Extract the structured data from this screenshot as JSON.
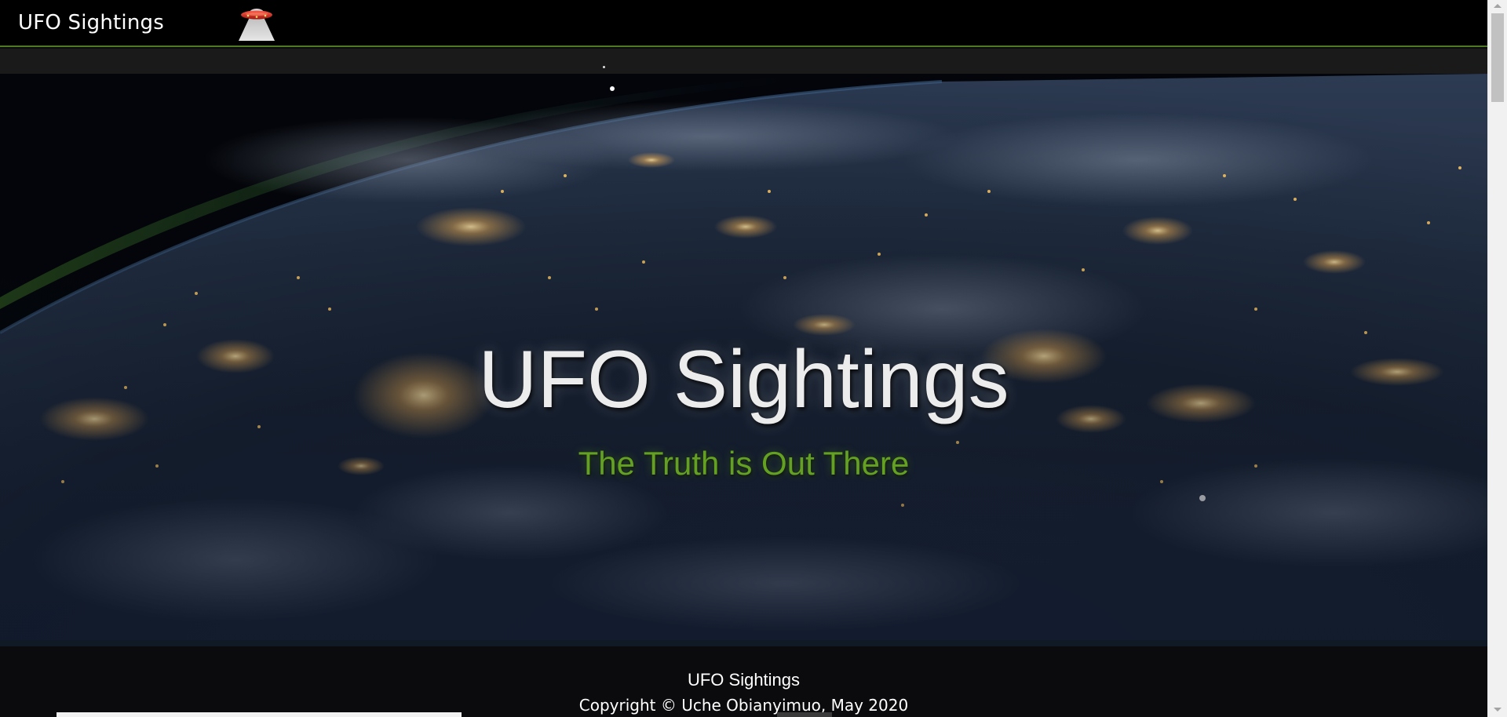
{
  "navbar": {
    "brand": "UFO Sightings",
    "logo_icon": "ufo-icon"
  },
  "hero": {
    "title": "UFO Sightings",
    "tagline": "The Truth is Out There",
    "background": "earth-at-night-from-space"
  },
  "footer": {
    "title": "UFO Sightings",
    "copyright": "Copyright © Uche Obianyimuo, May 2020"
  },
  "colors": {
    "navbar_bg": "#000000",
    "navbar_border": "#4f7a22",
    "accent_green": "#64a022",
    "title_white": "#ececec",
    "footer_bg": "#0b0b0d"
  }
}
